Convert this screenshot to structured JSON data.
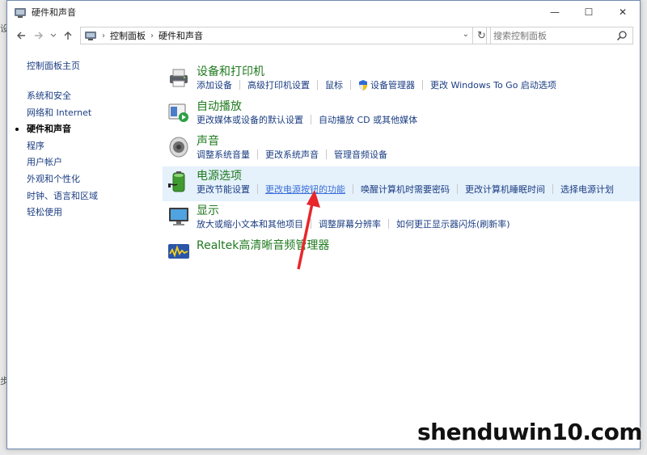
{
  "window": {
    "title": "硬件和声音",
    "icon": "control-panel-icon",
    "controls": {
      "minimize": "—",
      "maximize": "☐",
      "close": "✕"
    }
  },
  "addressbar": {
    "breadcrumbs": [
      "控制面板",
      "硬件和声音"
    ],
    "search_placeholder": "搜索控制面板"
  },
  "sidebar": {
    "home": "控制面板主页",
    "items": [
      {
        "label": "系统和安全",
        "active": false
      },
      {
        "label": "网络和 Internet",
        "active": false
      },
      {
        "label": "硬件和声音",
        "active": true
      },
      {
        "label": "程序",
        "active": false
      },
      {
        "label": "用户帐户",
        "active": false
      },
      {
        "label": "外观和个性化",
        "active": false
      },
      {
        "label": "时钟、语言和区域",
        "active": false
      },
      {
        "label": "轻松使用",
        "active": false
      }
    ]
  },
  "categories": [
    {
      "title": "设备和打印机",
      "icon": "printer-icon",
      "links": [
        "添加设备",
        "高级打印机设置",
        "鼠标",
        "设备管理器",
        "更改 Windows To Go 启动选项"
      ]
    },
    {
      "title": "自动播放",
      "icon": "autoplay-icon",
      "links": [
        "更改媒体或设备的默认设置",
        "自动播放 CD 或其他媒体"
      ]
    },
    {
      "title": "声音",
      "icon": "speaker-icon",
      "links": [
        "调整系统音量",
        "更改系统声音",
        "管理音频设备"
      ]
    },
    {
      "title": "电源选项",
      "icon": "battery-icon",
      "links": [
        "更改节能设置",
        "更改电源按钮的功能",
        "唤醒计算机时需要密码",
        "更改计算机睡眠时间",
        "选择电源计划"
      ]
    },
    {
      "title": "显示",
      "icon": "monitor-icon",
      "links": [
        "放大或缩小文本和其他项目",
        "调整屏幕分辨率",
        "如何更正显示器闪烁(刷新率)"
      ]
    },
    {
      "title": "Realtek高清晰音频管理器",
      "icon": "realtek-audio-icon",
      "links": []
    }
  ],
  "watermark": "shenduwin10.com",
  "colors": {
    "link": "#1b3d82",
    "category_title": "#1f7a1f",
    "highlight": "#e5f1fb",
    "arrow": "#e8262a"
  }
}
